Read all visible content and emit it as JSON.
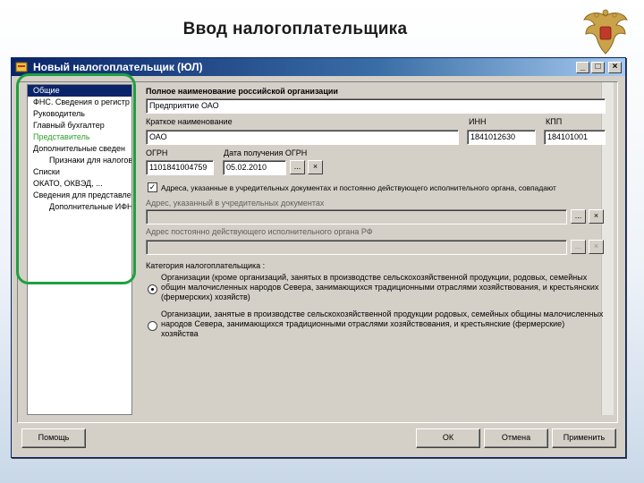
{
  "slide": {
    "title": "Ввод налогоплательщика"
  },
  "window": {
    "title": "Новый налогоплательщик (ЮЛ)",
    "controls": {
      "minimize": "_",
      "maximize": "□",
      "close": "×"
    }
  },
  "nav": {
    "items": [
      {
        "label": "Общие",
        "level": 0,
        "state": "selected"
      },
      {
        "label": "ФНС. Сведения о регистр",
        "level": 0,
        "state": ""
      },
      {
        "label": "Руководитель",
        "level": 0,
        "state": ""
      },
      {
        "label": "Главный бухгалтер",
        "level": 0,
        "state": ""
      },
      {
        "label": "Представитель",
        "level": 0,
        "state": "green"
      },
      {
        "label": "Дополнительные сведен",
        "level": 0,
        "state": ""
      },
      {
        "label": "Признаки для налогово",
        "level": 1,
        "state": ""
      },
      {
        "label": "Списки",
        "level": 0,
        "state": ""
      },
      {
        "label": "ОКАТО, ОКВЭД, ...",
        "level": 0,
        "state": ""
      },
      {
        "label": "Сведения для представле",
        "level": 0,
        "state": ""
      },
      {
        "label": "Дополнительные ИФН",
        "level": 1,
        "state": ""
      }
    ]
  },
  "form": {
    "full_name_label": "Полное наименование российской организации",
    "full_name_value": "Предприятие ОАО",
    "short_name_label": "Краткое наименование",
    "short_name_value": "ОАО",
    "inn_label": "ИНН",
    "inn_value": "1841012630",
    "kpp_label": "КПП",
    "kpp_value": "184101001",
    "ogrn_label": "ОГРН",
    "ogrn_value": "1101841004759",
    "ogrn_date_label": "Дата получения ОГРН",
    "ogrn_date_value": "05.02.2010",
    "picker_label": "...",
    "clear_label": "×",
    "same_address_label": "Адреса, указанные в учредительных документах и постоянно действующего исполнительного органа, совпадают",
    "same_address_checked": "✓",
    "founding_address_label": "Адрес, указанный в учредительных документах",
    "founding_address_value": "",
    "exec_address_label": "Адрес постоянно действующего исполнительного органа РФ",
    "exec_address_value": "",
    "category_label": "Категория налогоплательщика :",
    "category_options": [
      {
        "text": "Организации (кроме организаций, занятых в производстве сельскохозяйственной продукции, родовых, семейных общин малочисленных народов Севера, занимающихся традиционными отраслями хозяйствования, и крестьянских (фермерских) хозяйств)",
        "checked": true
      },
      {
        "text": "Организации, занятые в производстве сельскохозяйственной продукции родовых, семейных общины малочисленных народов Севера, занимающихся традиционными отраслями хозяйствования, и крестьянские (фермерские) хозяйства",
        "checked": false
      }
    ]
  },
  "footer": {
    "help_label": "Помощь",
    "ok_label": "ОК",
    "cancel_label": "Отмена",
    "apply_label": "Применить"
  },
  "colors": {
    "titlebar": "#0a246a",
    "selection": "#0a246a",
    "highlight_outline": "#20a040",
    "window_bg": "#d4d0c8"
  }
}
